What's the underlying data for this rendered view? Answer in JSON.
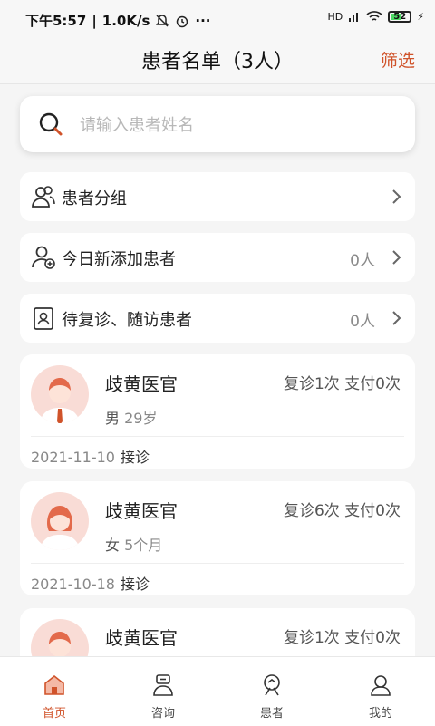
{
  "status_bar": {
    "time": "下午5:57",
    "speed": "1.0K/s",
    "signal": "HD",
    "battery": "52"
  },
  "header": {
    "title": "患者名单（3人）",
    "filter_label": "筛选"
  },
  "search": {
    "placeholder": "请输入患者姓名",
    "value": ""
  },
  "menu": [
    {
      "label": "患者分组",
      "count": "",
      "icon": "group-icon"
    },
    {
      "label": "今日新添加患者",
      "count": "0人",
      "icon": "add-patient-icon"
    },
    {
      "label": "待复诊、随访患者",
      "count": "0人",
      "icon": "followup-icon"
    }
  ],
  "patients": [
    {
      "name": "歧黄医官",
      "stats": "复诊1次 支付0次",
      "gender": "男",
      "age": "29岁",
      "date": "2021-11-10",
      "action": "接诊",
      "avatar": "male-avatar"
    },
    {
      "name": "歧黄医官",
      "stats": "复诊6次 支付0次",
      "gender": "女",
      "age": "5个月",
      "date": "2021-10-18",
      "action": "接诊",
      "avatar": "female-avatar"
    },
    {
      "name": "歧黄医官",
      "stats": "复诊1次 支付0次",
      "gender": "",
      "age": "",
      "date": "",
      "action": "",
      "avatar": "male-avatar"
    }
  ],
  "tabs": [
    {
      "label": "首页",
      "icon": "home-icon",
      "active": true
    },
    {
      "label": "咨询",
      "icon": "consult-icon",
      "active": false
    },
    {
      "label": "患者",
      "icon": "patients-icon",
      "active": false
    },
    {
      "label": "我的",
      "icon": "profile-icon",
      "active": false
    }
  ],
  "colors": {
    "accent": "#d0532a",
    "avatar_bg": "#f9dcd6"
  }
}
